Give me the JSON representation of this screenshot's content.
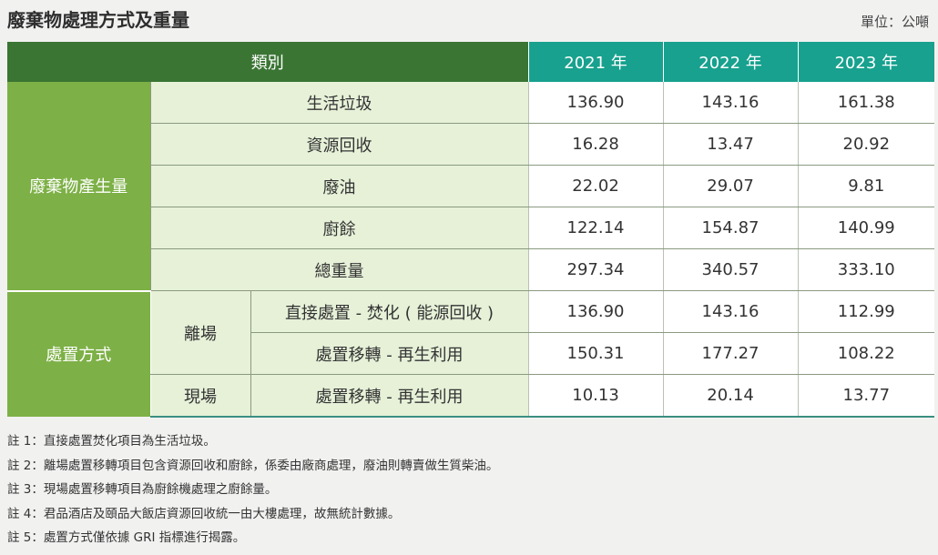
{
  "header": {
    "title": "廢棄物處理方式及重量",
    "unit": "單位：公噸"
  },
  "table": {
    "columns": [
      "類別",
      "2021 年",
      "2022 年",
      "2023 年"
    ],
    "groups": {
      "generation": "廢棄物產生量",
      "disposal": "處置方式"
    },
    "subgroups": {
      "offsite": "離場",
      "onsite": "現場"
    },
    "rows": [
      {
        "label": "生活垃圾",
        "values": [
          "136.90",
          "143.16",
          "161.38"
        ]
      },
      {
        "label": "資源回收",
        "values": [
          "16.28",
          "13.47",
          "20.92"
        ]
      },
      {
        "label": "廢油",
        "values": [
          "22.02",
          "29.07",
          "9.81"
        ]
      },
      {
        "label": "廚餘",
        "values": [
          "122.14",
          "154.87",
          "140.99"
        ]
      },
      {
        "label": "總重量",
        "values": [
          "297.34",
          "340.57",
          "333.10"
        ]
      },
      {
        "label": "直接處置 - 焚化 ( 能源回收 )",
        "values": [
          "136.90",
          "143.16",
          "112.99"
        ]
      },
      {
        "label": "處置移轉 - 再生利用",
        "values": [
          "150.31",
          "177.27",
          "108.22"
        ]
      },
      {
        "label": "處置移轉 - 再生利用",
        "values": [
          "10.13",
          "20.14",
          "13.77"
        ]
      }
    ]
  },
  "notes": [
    "註 1：直接處置焚化項目為生活垃圾。",
    "註 2：離場處置移轉項目包含資源回收和廚餘，係委由廠商處理，廢油則轉賣做生質柴油。",
    "註 3：現場處置移轉項目為廚餘機處理之廚餘量。",
    "註 4：君品酒店及頤品大飯店資源回收統一由大樓處理，故無統計數據。",
    "註 5：處置方式僅依據 GRI 指標進行揭露。"
  ],
  "colors": {
    "header_dark_green": "#3a7533",
    "header_teal": "#17a18e",
    "group_green": "#7db046",
    "item_light_green": "#e6f1d8"
  }
}
